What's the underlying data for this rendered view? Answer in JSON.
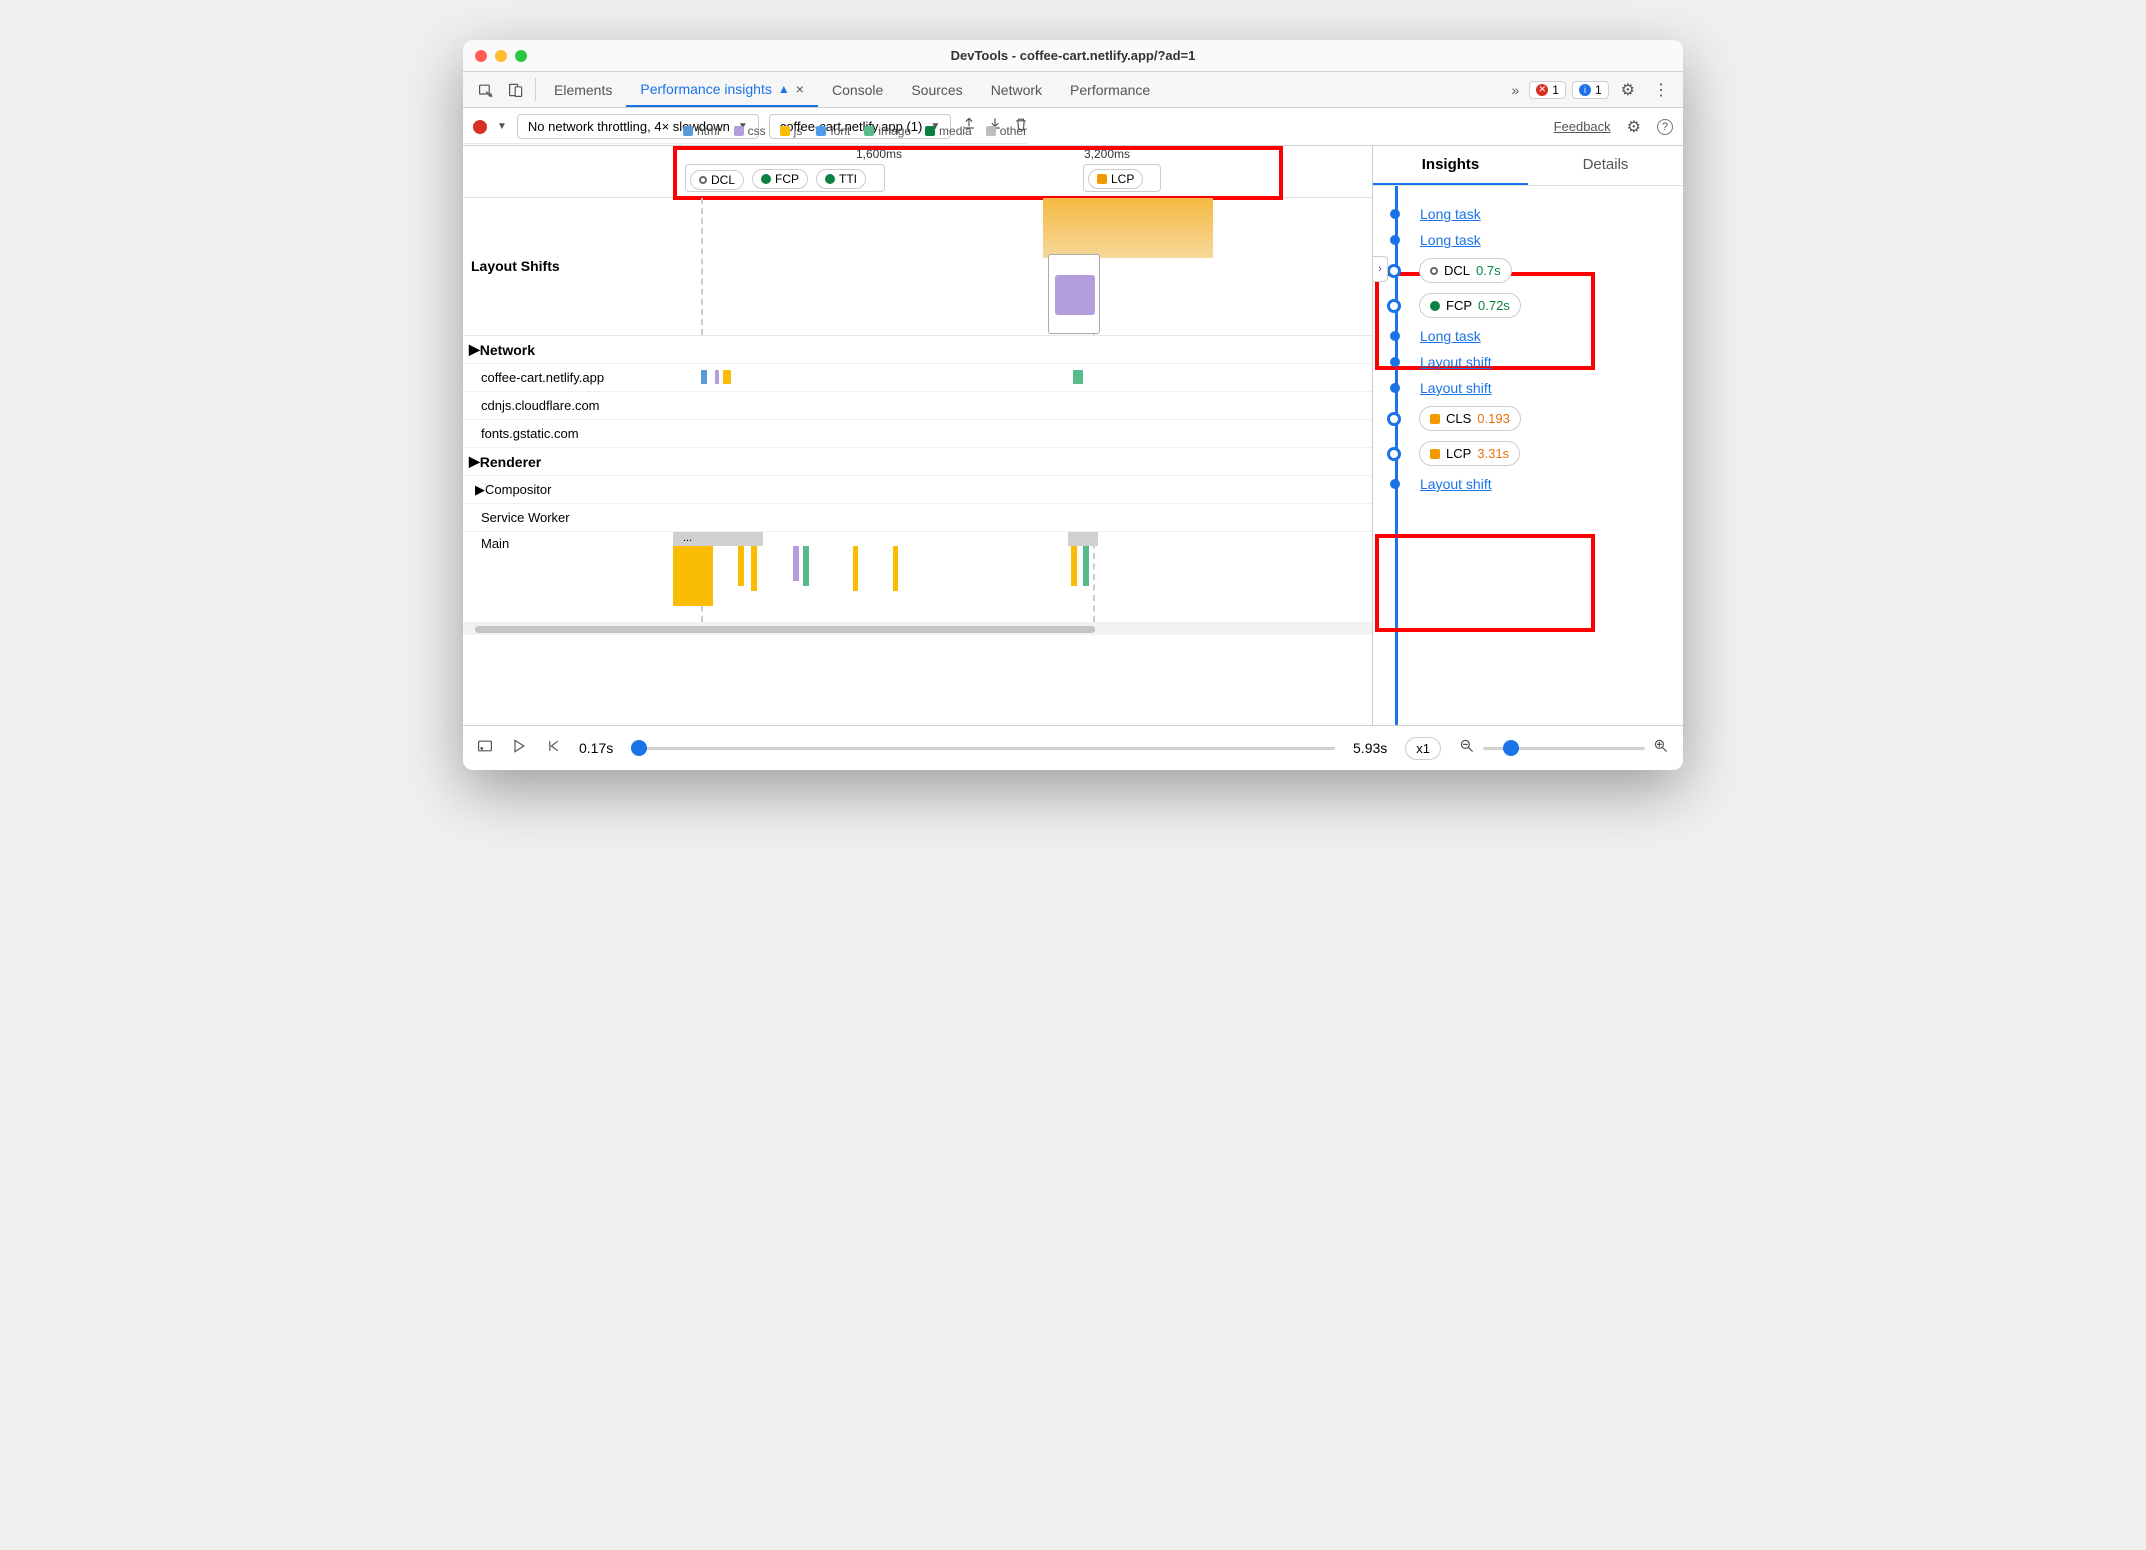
{
  "window": {
    "title": "DevTools - coffee-cart.netlify.app/?ad=1"
  },
  "tabbar": {
    "tabs": [
      "Elements",
      "Performance insights",
      "Console",
      "Sources",
      "Network",
      "Performance"
    ],
    "active": "Performance insights",
    "errors": "1",
    "messages": "1"
  },
  "toolbar": {
    "throttling": "No network throttling, 4× slowdown",
    "target": "coffee-cart.netlify.app (1)",
    "feedback": "Feedback"
  },
  "markers": {
    "m1_time": "1,600ms",
    "m1_items": [
      {
        "kind": "hollow",
        "label": "DCL"
      },
      {
        "kind": "green",
        "label": "FCP"
      },
      {
        "kind": "green",
        "label": "TTI"
      }
    ],
    "m2_time": "3,200ms",
    "m2_items": [
      {
        "kind": "orange-sq",
        "label": "LCP"
      }
    ]
  },
  "layout_shifts_label": "Layout Shifts",
  "legend": [
    {
      "label": "html",
      "color": "#5b9bd5"
    },
    {
      "label": "css",
      "color": "#b39ddb"
    },
    {
      "label": "js",
      "color": "#fbbc04"
    },
    {
      "label": "font",
      "color": "#4f9de8"
    },
    {
      "label": "image",
      "color": "#57bb8a"
    },
    {
      "label": "media",
      "color": "#0b8043"
    },
    {
      "label": "other",
      "color": "#bdbdbd"
    }
  ],
  "sections": {
    "network": "Network",
    "renderer": "Renderer",
    "compositor": "Compositor",
    "service_worker": "Service Worker",
    "main": "Main"
  },
  "network_rows": [
    "coffee-cart.netlify.app",
    "cdnjs.cloudflare.com",
    "fonts.gstatic.com"
  ],
  "insights_panel": {
    "tabs": {
      "insights": "Insights",
      "details": "Details"
    },
    "items": [
      {
        "type": "link",
        "label": "Long task"
      },
      {
        "type": "link",
        "label": "Long task"
      },
      {
        "type": "pill",
        "marker": "hollow",
        "label": "DCL",
        "value": "0.7s",
        "valClass": ""
      },
      {
        "type": "pill",
        "marker": "green",
        "label": "FCP",
        "value": "0.72s",
        "valClass": ""
      },
      {
        "type": "link",
        "label": "Long task"
      },
      {
        "type": "link",
        "label": "Layout shift"
      },
      {
        "type": "link",
        "label": "Layout shift"
      },
      {
        "type": "pill",
        "marker": "orange-sq",
        "label": "CLS",
        "value": "0.193",
        "valClass": "orange"
      },
      {
        "type": "pill",
        "marker": "orange-sq",
        "label": "LCP",
        "value": "3.31s",
        "valClass": "orange"
      },
      {
        "type": "link",
        "label": "Layout shift"
      }
    ]
  },
  "footer": {
    "start": "0.17s",
    "end": "5.93s",
    "speed": "x1"
  },
  "overflow": "..."
}
